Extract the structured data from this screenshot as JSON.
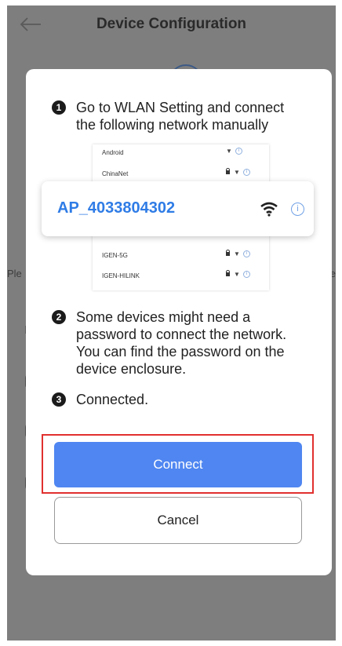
{
  "header": {
    "title": "Device Configuration"
  },
  "background": {
    "edge_left_text": "Ple",
    "edge_right_text": "ne"
  },
  "dialog": {
    "steps": [
      {
        "number": "1",
        "text": "Go to WLAN Setting and connect the following network manually"
      },
      {
        "number": "2",
        "text": "Some devices might need a password to connect the network. You can find the password on the device enclosure."
      },
      {
        "number": "3",
        "text": "Connected."
      }
    ],
    "network_list": [
      "Android",
      "ChinaNet",
      "IGEN-5G",
      "IGEN-HILINK"
    ],
    "network_locked": [
      false,
      true,
      true,
      true
    ],
    "ap_name": "AP_4033804302",
    "connect_label": "Connect",
    "cancel_label": "Cancel"
  },
  "colors": {
    "accent": "#4f86f1",
    "ap_text": "#2f7ce6",
    "highlight": "#e0302e",
    "overlay": "#7e7e7e"
  },
  "icons": [
    "back-arrow-icon",
    "wifi-icon",
    "info-icon",
    "lock-icon"
  ]
}
